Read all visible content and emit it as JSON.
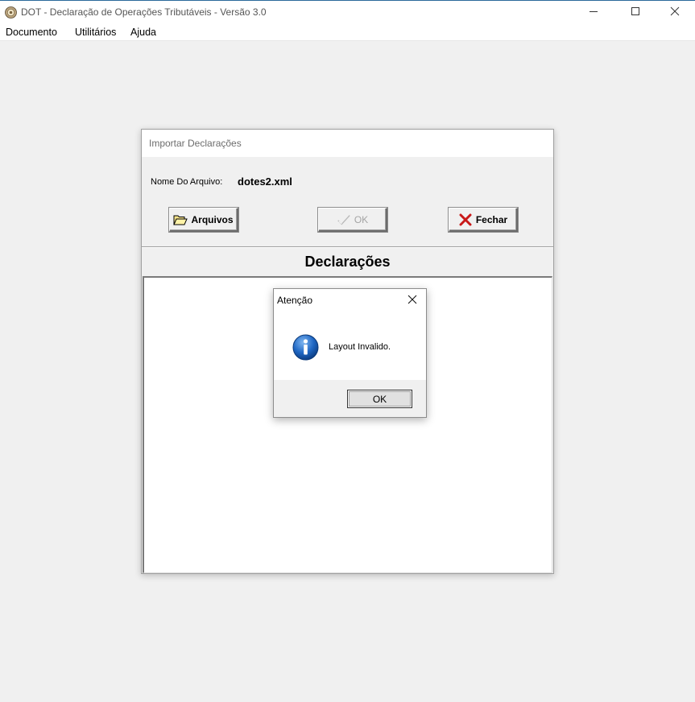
{
  "window": {
    "title": "DOT - Declaração de Operações Tributáveis  - Versão 3.0",
    "icon": "app-seal-icon",
    "controls": [
      "minimize-icon",
      "maximize-icon",
      "close-icon"
    ]
  },
  "menubar": {
    "items": [
      {
        "label": "Documento"
      },
      {
        "label": "Utilitários"
      },
      {
        "label": "Ajuda"
      }
    ]
  },
  "import_dialog": {
    "title": "Importar Declarações",
    "file_label": "Nome Do Arquivo:",
    "file_value": "dotes2.xml",
    "buttons": {
      "arquivos": {
        "label": "Arquivos",
        "icon": "folder-open-icon"
      },
      "ok": {
        "label": "OK",
        "icon": "checkmark-icon",
        "enabled": false
      },
      "fechar": {
        "label": "Fechar",
        "icon": "red-x-icon"
      }
    },
    "section_header": "Declarações"
  },
  "alert": {
    "title": "Atenção",
    "message": "Layout Invalido.",
    "ok_label": "OK",
    "icon": "info-icon",
    "colors": {
      "info_blue": "#1f67c4"
    }
  }
}
